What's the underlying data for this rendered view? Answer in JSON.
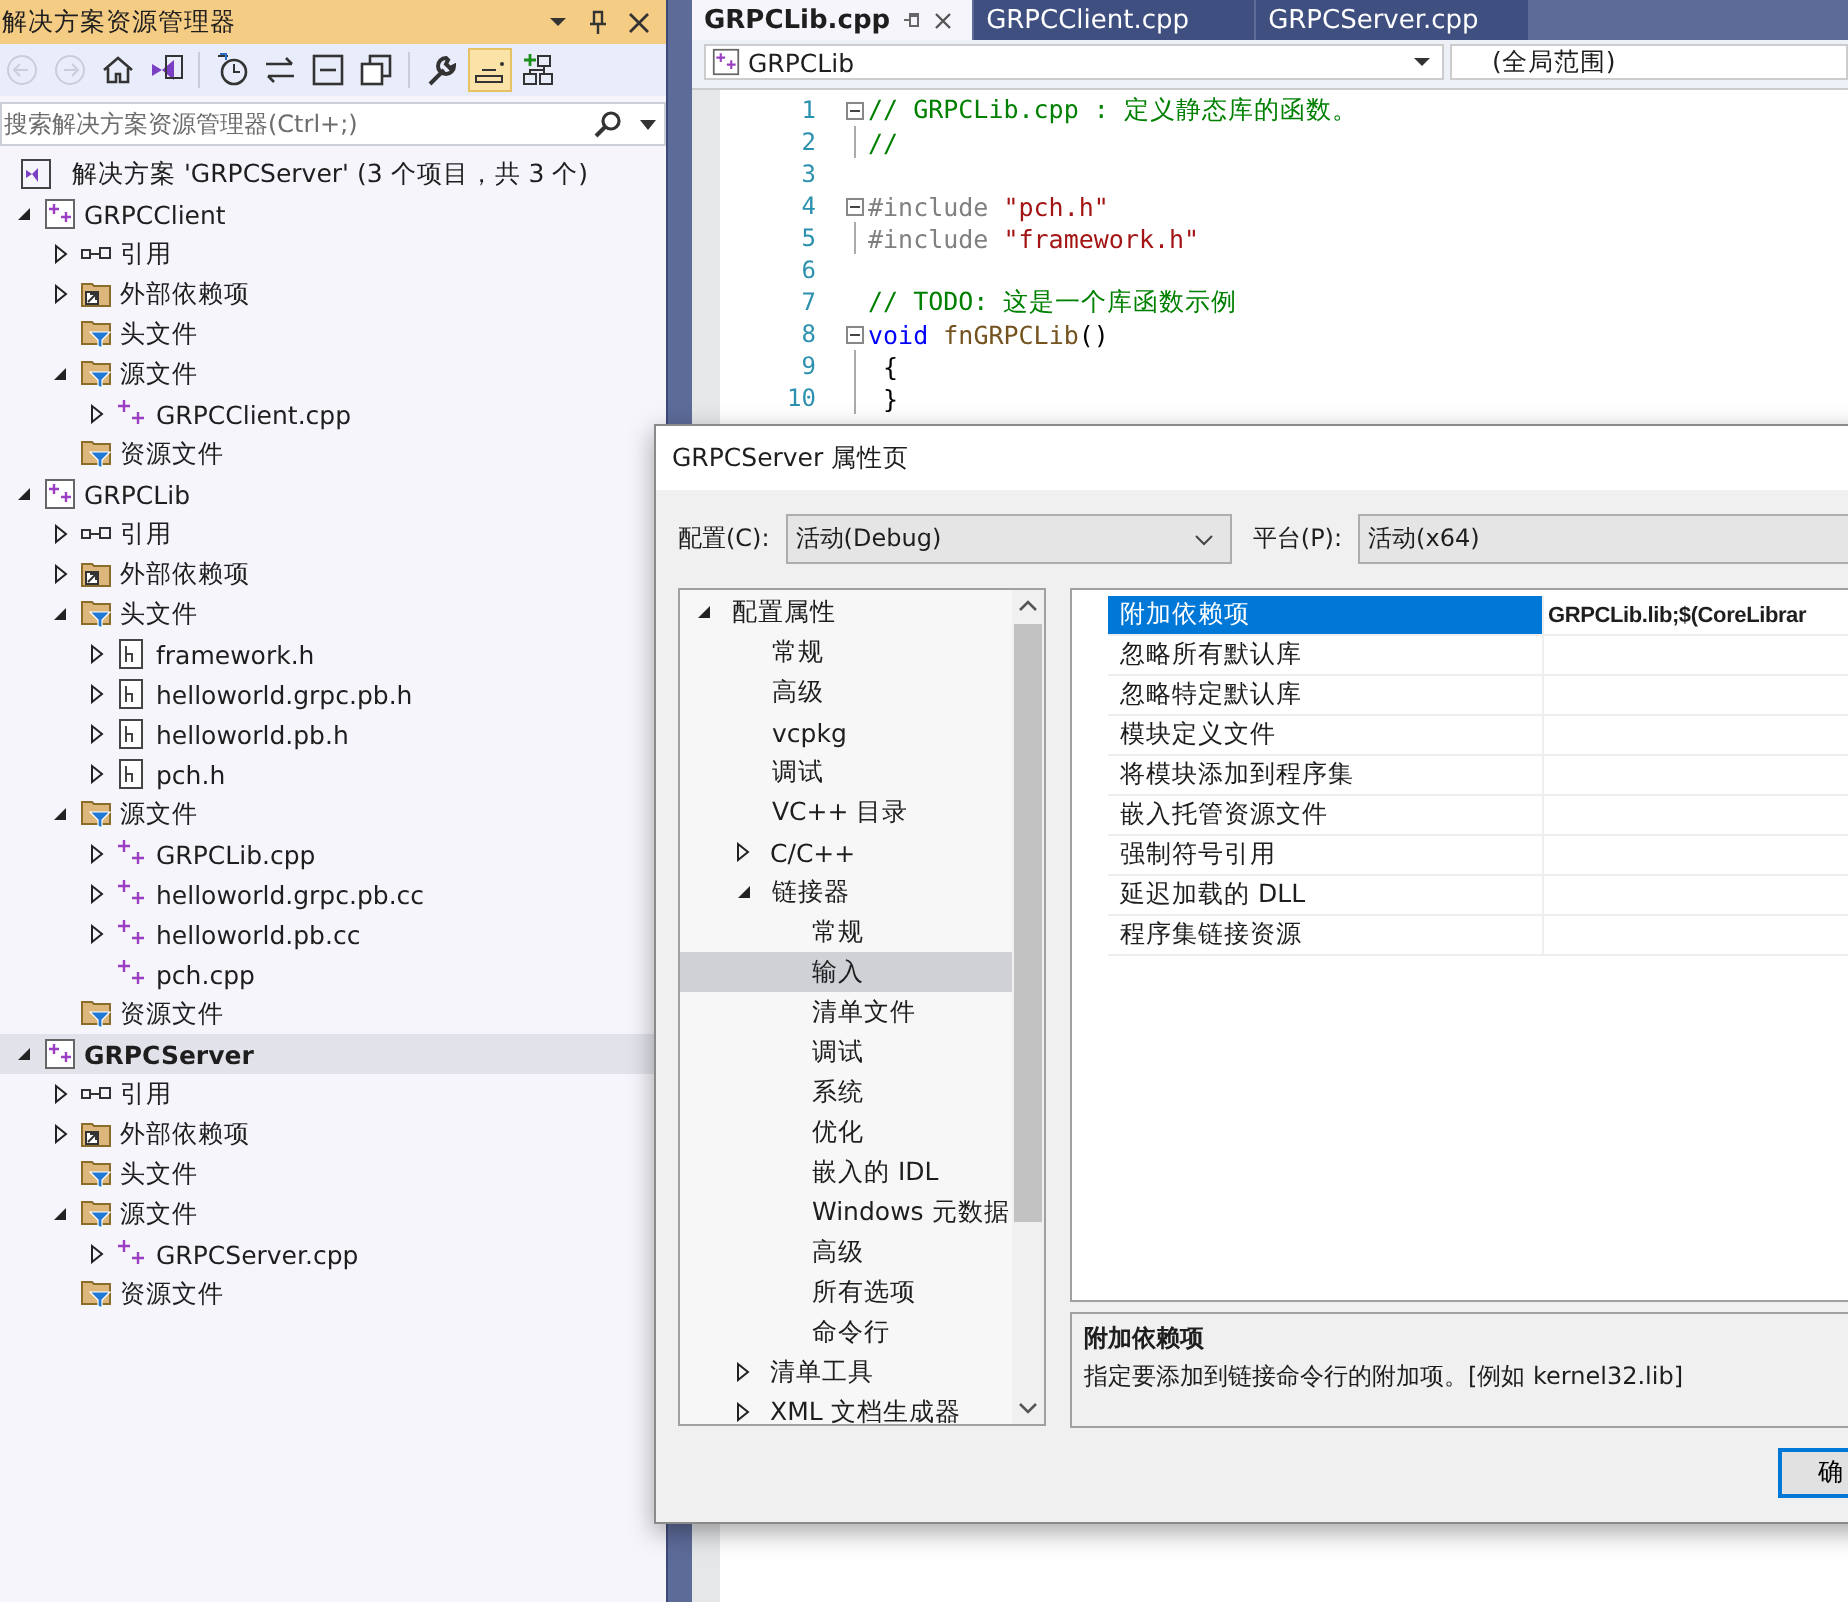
{
  "explorer": {
    "title": "解决方案资源管理器",
    "toolbar": [
      {
        "kind": "back",
        "disabled": true,
        "on": false
      },
      {
        "kind": "forward",
        "disabled": true,
        "on": false
      },
      {
        "kind": "home",
        "disabled": false,
        "on": false
      },
      {
        "kind": "switch-views",
        "disabled": false,
        "on": false
      },
      {
        "kind": "history",
        "disabled": false,
        "on": false
      },
      {
        "kind": "sync",
        "disabled": false,
        "on": false
      },
      {
        "kind": "collapse",
        "disabled": false,
        "on": false
      },
      {
        "kind": "copies",
        "disabled": false,
        "on": false
      },
      {
        "kind": "properties",
        "disabled": false,
        "on": false
      },
      {
        "kind": "preview",
        "disabled": false,
        "on": true
      },
      {
        "kind": "hierarchy",
        "disabled": false,
        "on": false
      }
    ],
    "search": {
      "placeholder": "搜索解决方案资源管理器(Ctrl+;)"
    },
    "solution": {
      "label": "解决方案 'GRPCServer' (3 个项目，共 3 个)"
    },
    "tree": [
      {
        "label": "GRPCClient",
        "kind": "project",
        "expanded": true,
        "selected": false,
        "children": [
          {
            "label": "引用",
            "kind": "references",
            "expanded": false,
            "selected": false
          },
          {
            "label": "外部依赖项",
            "kind": "external",
            "expanded": false,
            "selected": false
          },
          {
            "label": "头文件",
            "kind": "filter",
            "selected": false
          },
          {
            "label": "源文件",
            "kind": "filter",
            "expanded": true,
            "selected": false,
            "children": [
              {
                "label": "GRPCClient.cpp",
                "kind": "cpp",
                "expanded": false,
                "selected": false
              }
            ]
          },
          {
            "label": "资源文件",
            "kind": "filter",
            "selected": false
          }
        ]
      },
      {
        "label": "GRPCLib",
        "kind": "project",
        "expanded": true,
        "selected": false,
        "children": [
          {
            "label": "引用",
            "kind": "references",
            "expanded": false,
            "selected": false
          },
          {
            "label": "外部依赖项",
            "kind": "external",
            "expanded": false,
            "selected": false
          },
          {
            "label": "头文件",
            "kind": "filter",
            "expanded": true,
            "selected": false,
            "children": [
              {
                "label": "framework.h",
                "kind": "header",
                "expanded": false,
                "selected": false
              },
              {
                "label": "helloworld.grpc.pb.h",
                "kind": "header",
                "expanded": false,
                "selected": false
              },
              {
                "label": "helloworld.pb.h",
                "kind": "header",
                "expanded": false,
                "selected": false
              },
              {
                "label": "pch.h",
                "kind": "header",
                "expanded": false,
                "selected": false
              }
            ]
          },
          {
            "label": "源文件",
            "kind": "filter",
            "expanded": true,
            "selected": false,
            "children": [
              {
                "label": "GRPCLib.cpp",
                "kind": "cpp",
                "expanded": false,
                "selected": false
              },
              {
                "label": "helloworld.grpc.pb.cc",
                "kind": "cpp",
                "expanded": false,
                "selected": false
              },
              {
                "label": "helloworld.pb.cc",
                "kind": "cpp",
                "expanded": false,
                "selected": false
              },
              {
                "label": "pch.cpp",
                "kind": "cpp",
                "selected": false
              }
            ]
          },
          {
            "label": "资源文件",
            "kind": "filter",
            "selected": false
          }
        ]
      },
      {
        "label": "GRPCServer",
        "kind": "project",
        "expanded": true,
        "selected": true,
        "children": [
          {
            "label": "引用",
            "kind": "references",
            "expanded": false,
            "selected": false
          },
          {
            "label": "外部依赖项",
            "kind": "external",
            "expanded": false,
            "selected": false
          },
          {
            "label": "头文件",
            "kind": "filter",
            "selected": false
          },
          {
            "label": "源文件",
            "kind": "filter",
            "expanded": true,
            "selected": false,
            "children": [
              {
                "label": "GRPCServer.cpp",
                "kind": "cpp",
                "expanded": false,
                "selected": false
              }
            ]
          },
          {
            "label": "资源文件",
            "kind": "filter",
            "selected": false
          }
        ]
      }
    ]
  },
  "editor": {
    "tabs": [
      {
        "label": "GRPCLib.cpp",
        "selected": true
      },
      {
        "label": "GRPCClient.cpp",
        "selected": false
      },
      {
        "label": "GRPCServer.cpp",
        "selected": false
      }
    ],
    "project_dropdown": "GRPCLib",
    "scope_dropdown": "(全局范围)",
    "lines": [
      {
        "number": "1",
        "collapsible": true,
        "guide": false,
        "tokens": [
          {
            "kind": "comment",
            "text": "// GRPCLib.cpp : 定义静态库的函数。"
          }
        ]
      },
      {
        "number": "2",
        "collapsible": false,
        "guide": true,
        "tokens": [
          {
            "kind": "comment",
            "text": "//"
          }
        ]
      },
      {
        "number": "3",
        "collapsible": false,
        "guide": false
      },
      {
        "number": "4",
        "collapsible": true,
        "guide": false,
        "tokens": [
          {
            "kind": "directive",
            "text": "#include "
          },
          {
            "kind": "string",
            "text": "\"pch.h\""
          }
        ]
      },
      {
        "number": "5",
        "collapsible": false,
        "guide": true,
        "tokens": [
          {
            "kind": "directive",
            "text": "#include "
          },
          {
            "kind": "string",
            "text": "\"framework.h\""
          }
        ]
      },
      {
        "number": "6",
        "collapsible": false,
        "guide": false
      },
      {
        "number": "7",
        "collapsible": false,
        "guide": false,
        "tokens": [
          {
            "kind": "comment",
            "text": "// TODO: 这是一个库函数示例"
          }
        ]
      },
      {
        "number": "8",
        "collapsible": true,
        "guide": false,
        "tokens": [
          {
            "kind": "keyword",
            "text": "void "
          },
          {
            "kind": "function",
            "text": "fnGRPCLib"
          },
          {
            "kind": "plain",
            "text": "()"
          }
        ]
      },
      {
        "number": "9",
        "collapsible": false,
        "guide": true,
        "tokens": [
          {
            "kind": "plain",
            "text": " {"
          }
        ]
      },
      {
        "number": "10",
        "collapsible": false,
        "guide": true,
        "tokens": [
          {
            "kind": "plain",
            "text": " }"
          }
        ]
      }
    ]
  },
  "dialog": {
    "title": "GRPCServer 属性页",
    "config_label": "配置(C):",
    "config_value": "活动(Debug)",
    "platform_label": "平台(P):",
    "platform_value": "活动(x64)",
    "nav": [
      {
        "label": "配置属性",
        "expanded": true,
        "selected": false,
        "children": [
          {
            "label": "常规",
            "selected": false
          },
          {
            "label": "高级",
            "selected": false
          },
          {
            "label": "vcpkg",
            "selected": false
          },
          {
            "label": "调试",
            "selected": false
          },
          {
            "label": "VC++ 目录",
            "selected": false
          },
          {
            "label": "C/C++",
            "expanded": false,
            "selected": false
          },
          {
            "label": "链接器",
            "expanded": true,
            "selected": false,
            "children": [
              {
                "label": "常规",
                "selected": false
              },
              {
                "label": "输入",
                "selected": true
              },
              {
                "label": "清单文件",
                "selected": false
              },
              {
                "label": "调试",
                "selected": false
              },
              {
                "label": "系统",
                "selected": false
              },
              {
                "label": "优化",
                "selected": false
              },
              {
                "label": "嵌入的 IDL",
                "selected": false
              },
              {
                "label": "Windows 元数据",
                "selected": false
              },
              {
                "label": "高级",
                "selected": false
              },
              {
                "label": "所有选项",
                "selected": false
              },
              {
                "label": "命令行",
                "selected": false
              }
            ]
          },
          {
            "label": "清单工具",
            "expanded": false,
            "selected": false
          },
          {
            "label": "XML 文档生成器",
            "expanded": false,
            "selected": false
          }
        ]
      }
    ],
    "properties": [
      {
        "name": "附加依赖项",
        "value": "GRPCLib.lib;$(CoreLibrar",
        "selected": true
      },
      {
        "name": "忽略所有默认库",
        "selected": false
      },
      {
        "name": "忽略特定默认库",
        "selected": false
      },
      {
        "name": "模块定义文件",
        "selected": false
      },
      {
        "name": "将模块添加到程序集",
        "selected": false
      },
      {
        "name": "嵌入托管资源文件",
        "selected": false
      },
      {
        "name": "强制符号引用",
        "selected": false
      },
      {
        "name": "延迟加载的 DLL",
        "selected": false
      },
      {
        "name": "程序集链接资源",
        "selected": false
      }
    ],
    "description": {
      "title": "附加依赖项",
      "text": "指定要添加到链接命令行的附加项。[例如 kernel32.lib]"
    },
    "ok_button": "确"
  }
}
